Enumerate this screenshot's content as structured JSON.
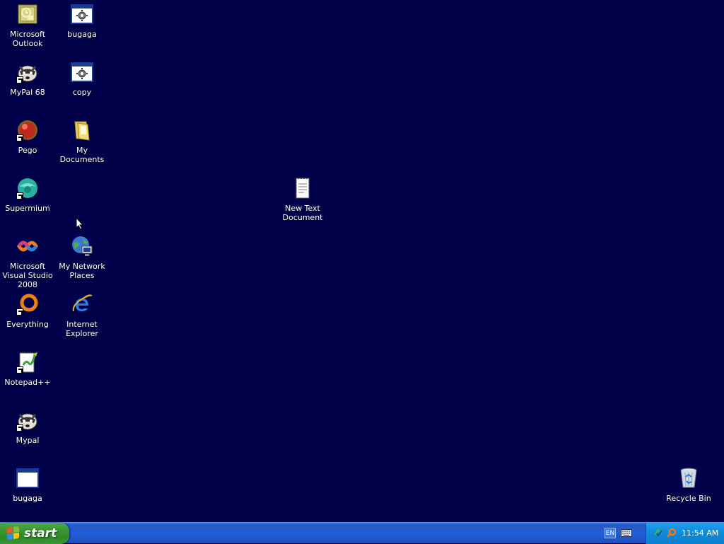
{
  "desktop": {
    "background_color": "#02024a",
    "icons": [
      {
        "label": "Microsoft Outlook",
        "icon": "outlook-icon",
        "shortcut": false
      },
      {
        "label": "bugaga",
        "icon": "window-gear-icon",
        "shortcut": false
      },
      {
        "label": "MyPal 68",
        "icon": "raccoon-icon",
        "shortcut": true
      },
      {
        "label": "copy",
        "icon": "window-gear-icon",
        "shortcut": false
      },
      {
        "label": "Pego",
        "icon": "red-ball-icon",
        "shortcut": true
      },
      {
        "label": "My Documents",
        "icon": "folder-icon",
        "shortcut": false
      },
      {
        "label": "Supermium",
        "icon": "supermium-icon",
        "shortcut": true
      },
      {
        "label": "New Text Document",
        "icon": "text-document-icon",
        "shortcut": false
      },
      {
        "label": "Microsoft Visual Studio 2008",
        "icon": "visual-studio-icon",
        "shortcut": false
      },
      {
        "label": "My Network Places",
        "icon": "network-places-icon",
        "shortcut": false
      },
      {
        "label": "Everything",
        "icon": "everything-search-icon",
        "shortcut": true
      },
      {
        "label": "Internet Explorer",
        "icon": "internet-explorer-icon",
        "shortcut": false
      },
      {
        "label": "Notepad++",
        "icon": "notepad-plus-plus-icon",
        "shortcut": true
      },
      {
        "label": "Mypal",
        "icon": "raccoon-icon",
        "shortcut": true
      },
      {
        "label": "bugaga",
        "icon": "blank-window-icon",
        "shortcut": false
      },
      {
        "label": "Recycle Bin",
        "icon": "recycle-bin-icon",
        "shortcut": false
      }
    ]
  },
  "taskbar": {
    "start_label": "start",
    "language": "EN",
    "clock": "11:54 AM",
    "colors": {
      "taskbar": "#245dd8",
      "start": "#3c9a36",
      "tray": "#0f8ad8"
    }
  }
}
